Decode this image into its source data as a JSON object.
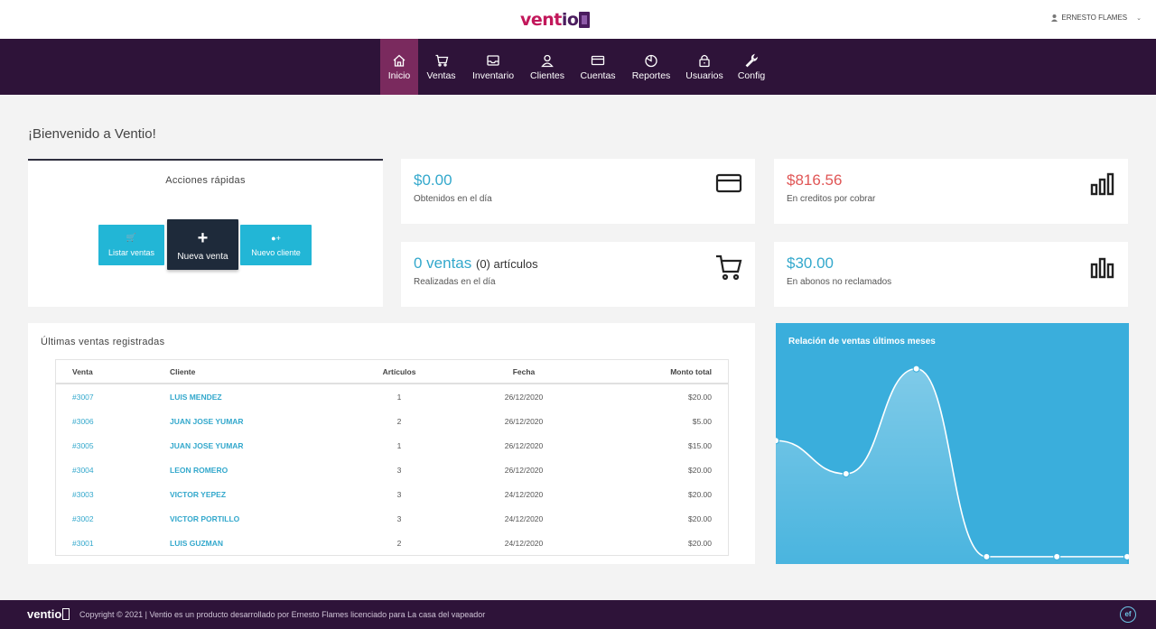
{
  "brand": {
    "logo": "ventio",
    "accent": "#c2185b",
    "nav_bg": "#2e1339"
  },
  "user": {
    "name": "ERNESTO FLAMES"
  },
  "nav": {
    "items": [
      {
        "label": "Inicio",
        "icon": "home-icon",
        "active": true
      },
      {
        "label": "Ventas",
        "icon": "cart-icon"
      },
      {
        "label": "Inventario",
        "icon": "inbox-icon"
      },
      {
        "label": "Clientes",
        "icon": "user-icon"
      },
      {
        "label": "Cuentas",
        "icon": "card-icon"
      },
      {
        "label": "Reportes",
        "icon": "pie-chart-icon"
      },
      {
        "label": "Usuarios",
        "icon": "lock-icon"
      },
      {
        "label": "Config",
        "icon": "wrench-icon"
      }
    ]
  },
  "welcome": "¡Bienvenido a Ventio!",
  "quick_actions": {
    "title": "Acciones rápidas",
    "list_sales": "Listar ventas",
    "new_sale": "Nueva venta",
    "new_client": "Nuevo cliente"
  },
  "stats": {
    "day_earnings": {
      "value": "$0.00",
      "label": "Obtenidos en el día"
    },
    "credits": {
      "value": "$816.56",
      "label": "En creditos por cobrar"
    },
    "day_sales": {
      "value": "0 ventas",
      "extra": "(0) artículos",
      "label": "Realizadas en el día"
    },
    "deposits": {
      "value": "$30.00",
      "label": "En abonos no reclamados"
    }
  },
  "sales": {
    "title": "Últimas ventas registradas",
    "columns": [
      "Venta",
      "Cliente",
      "Artículos",
      "Fecha",
      "Monto total"
    ],
    "rows": [
      [
        "#3007",
        "LUIS MENDEZ",
        "1",
        "26/12/2020",
        "$20.00"
      ],
      [
        "#3006",
        "JUAN JOSE YUMAR",
        "2",
        "26/12/2020",
        "$5.00"
      ],
      [
        "#3005",
        "JUAN JOSE YUMAR",
        "1",
        "26/12/2020",
        "$15.00"
      ],
      [
        "#3004",
        "LEON ROMERO",
        "3",
        "26/12/2020",
        "$20.00"
      ],
      [
        "#3003",
        "VICTOR YEPEZ",
        "3",
        "24/12/2020",
        "$20.00"
      ],
      [
        "#3002",
        "VICTOR PORTILLO",
        "3",
        "24/12/2020",
        "$20.00"
      ],
      [
        "#3001",
        "LUIS GUZMAN",
        "2",
        "24/12/2020",
        "$20.00"
      ]
    ]
  },
  "chart_data": {
    "type": "area",
    "title": "Relación de ventas últimos meses",
    "x": [
      0,
      1,
      2,
      3,
      4,
      5
    ],
    "values": [
      110,
      80,
      175,
      5,
      5,
      5
    ],
    "ylim": [
      0,
      200
    ],
    "grid": false,
    "color": "#3aaedc"
  },
  "footer": {
    "logo": "ventio",
    "copyright": "Copyright © 2021 | Ventio es un producto desarrollado por Ernesto Flames licenciado para La casa del vapeador",
    "badge": "ef"
  }
}
